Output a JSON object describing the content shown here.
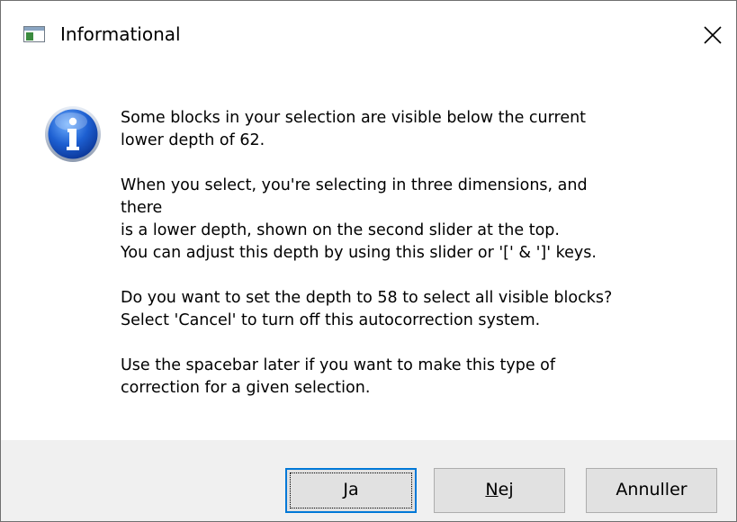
{
  "window": {
    "title": "Informational",
    "close_icon": "close-icon",
    "app_icon": "app-window-icon"
  },
  "message": {
    "icon": "info-icon",
    "paragraph1_line1": "Some blocks in your selection are visible below the current",
    "paragraph1_line2": "lower depth of 62.",
    "paragraph2_line1": "When you select, you're selecting in three dimensions, and",
    "paragraph2_line2": "there",
    "paragraph2_line3": "is a lower depth, shown on the second slider at the top.",
    "paragraph2_line4": "You can adjust this depth by using this slider or '[' & ']' keys.",
    "paragraph3_line1": "Do you want to set the depth to 58 to select all visible blocks?",
    "paragraph3_line2": "Select 'Cancel' to turn off this autocorrection system.",
    "paragraph4_line1": "Use the spacebar later if you want to make this type of",
    "paragraph4_line2": "correction for a given selection."
  },
  "buttons": {
    "yes": {
      "mnemonic": "J",
      "rest": "a"
    },
    "no": {
      "mnemonic": "N",
      "rest": "ej"
    },
    "cancel": {
      "label": "Annuller"
    }
  },
  "colors": {
    "accent": "#0078d7",
    "footer_bg": "#f0f0f0",
    "button_bg": "#e1e1e1"
  }
}
